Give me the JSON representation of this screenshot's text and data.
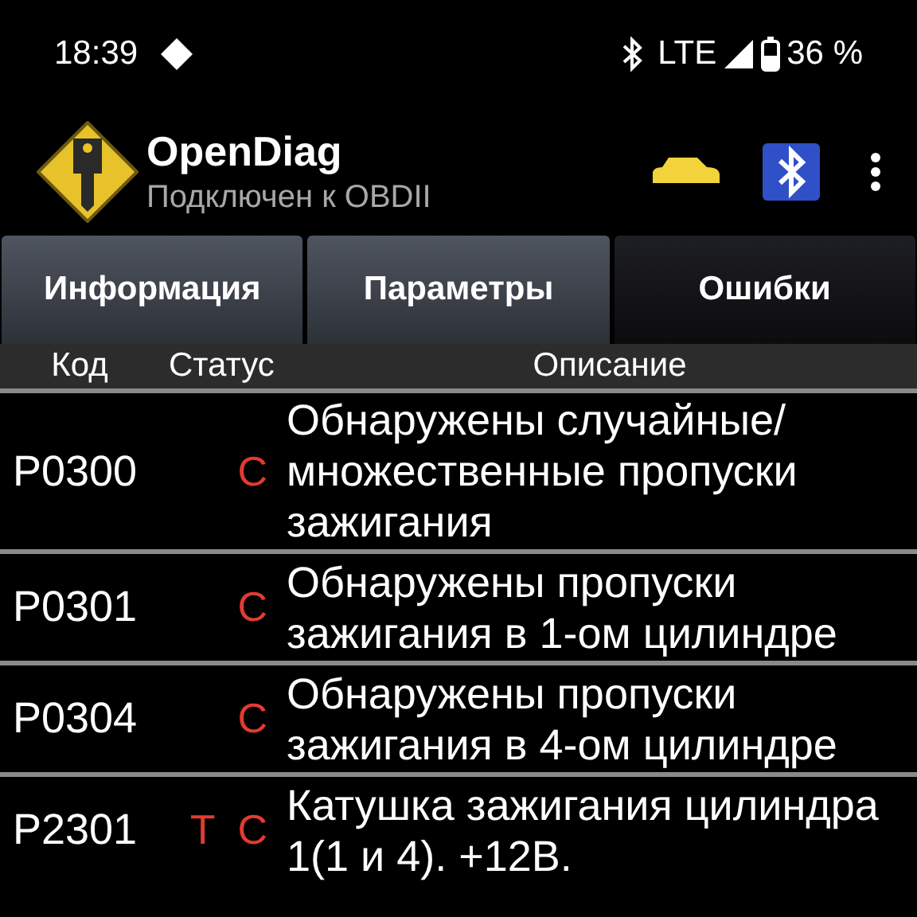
{
  "status_bar": {
    "time": "18:39",
    "network": "LTE",
    "battery": "36 %"
  },
  "app_bar": {
    "title": "OpenDiag",
    "subtitle": "Подключен к OBDII"
  },
  "tabs": [
    {
      "label": "Информация",
      "selected": false
    },
    {
      "label": "Параметры",
      "selected": false
    },
    {
      "label": "Ошибки",
      "selected": true
    }
  ],
  "table": {
    "columns": [
      "Код",
      "Статус",
      "Описание"
    ],
    "rows": [
      {
        "code": "P0300",
        "status": [
          "C"
        ],
        "description": "Обнаружены случайные/ множественные пропуски зажигания"
      },
      {
        "code": "P0301",
        "status": [
          "C"
        ],
        "description": "Обнаружены пропуски зажигания в 1-ом цилиндре"
      },
      {
        "code": "P0304",
        "status": [
          "C"
        ],
        "description": "Обнаружены пропуски зажигания в 4-ом цилиндре"
      },
      {
        "code": "P2301",
        "status": [
          "T",
          "C"
        ],
        "description": "Катушка зажигания цилиндра 1(1 и 4). +12В."
      }
    ]
  }
}
